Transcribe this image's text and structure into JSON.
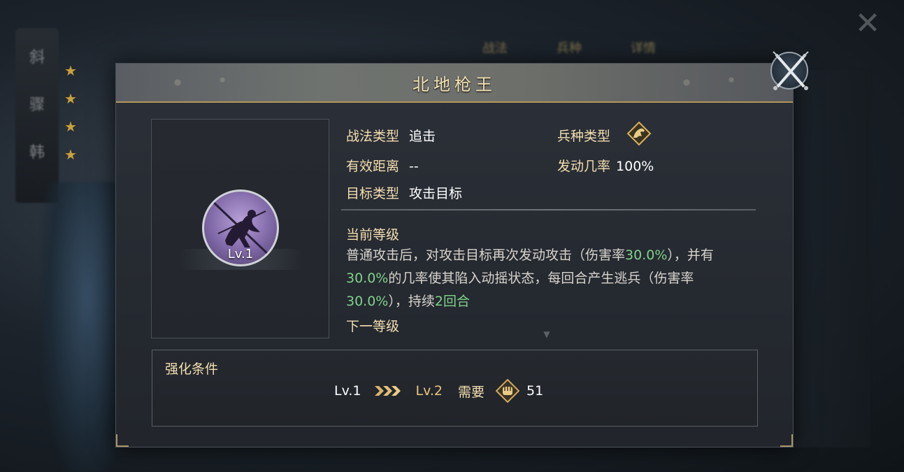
{
  "background": {
    "banner_glyphs": [
      "斜",
      "骤",
      "韩"
    ],
    "tabs": [
      "战法",
      "兵种",
      "详情"
    ],
    "star_count": 4
  },
  "dialog": {
    "title": "北地枪王",
    "close_icon": "crossed-swords-close-icon",
    "skill": {
      "level": "Lv.1",
      "icon": "spearman-silhouette-icon"
    },
    "info": {
      "type_label": "战法类型",
      "type_value": "追击",
      "range_label": "有效距离",
      "range_value": "--",
      "target_label": "目标类型",
      "target_value": "攻击目标",
      "troop_label": "兵种类型",
      "troop_icon": "cavalry-horse-icon",
      "rate_label": "发动几率",
      "rate_value": "100%"
    },
    "current_level_label": "当前等级",
    "description": {
      "p1": "普通攻击后，对攻击目标再次发动攻击（伤害率",
      "v1": "30.0%",
      "p2": "），并有",
      "v2": "30.0%",
      "p3": "的几率使其陷入动摇状态，每回合产生逃兵（伤害率",
      "v3": "30.0%",
      "p4": "），持续",
      "v4": "2回合"
    },
    "next_level_label": "下一等级",
    "enhance": {
      "title": "强化条件",
      "from_level": "Lv.1",
      "to_level": "Lv.2",
      "need_label": "需要",
      "token_icon": "fist-token-icon",
      "need_count": "51"
    }
  },
  "colors": {
    "highlight_green": "#7fd28a",
    "gold_label": "#f3dfb0",
    "header_border": "#b4955a"
  }
}
